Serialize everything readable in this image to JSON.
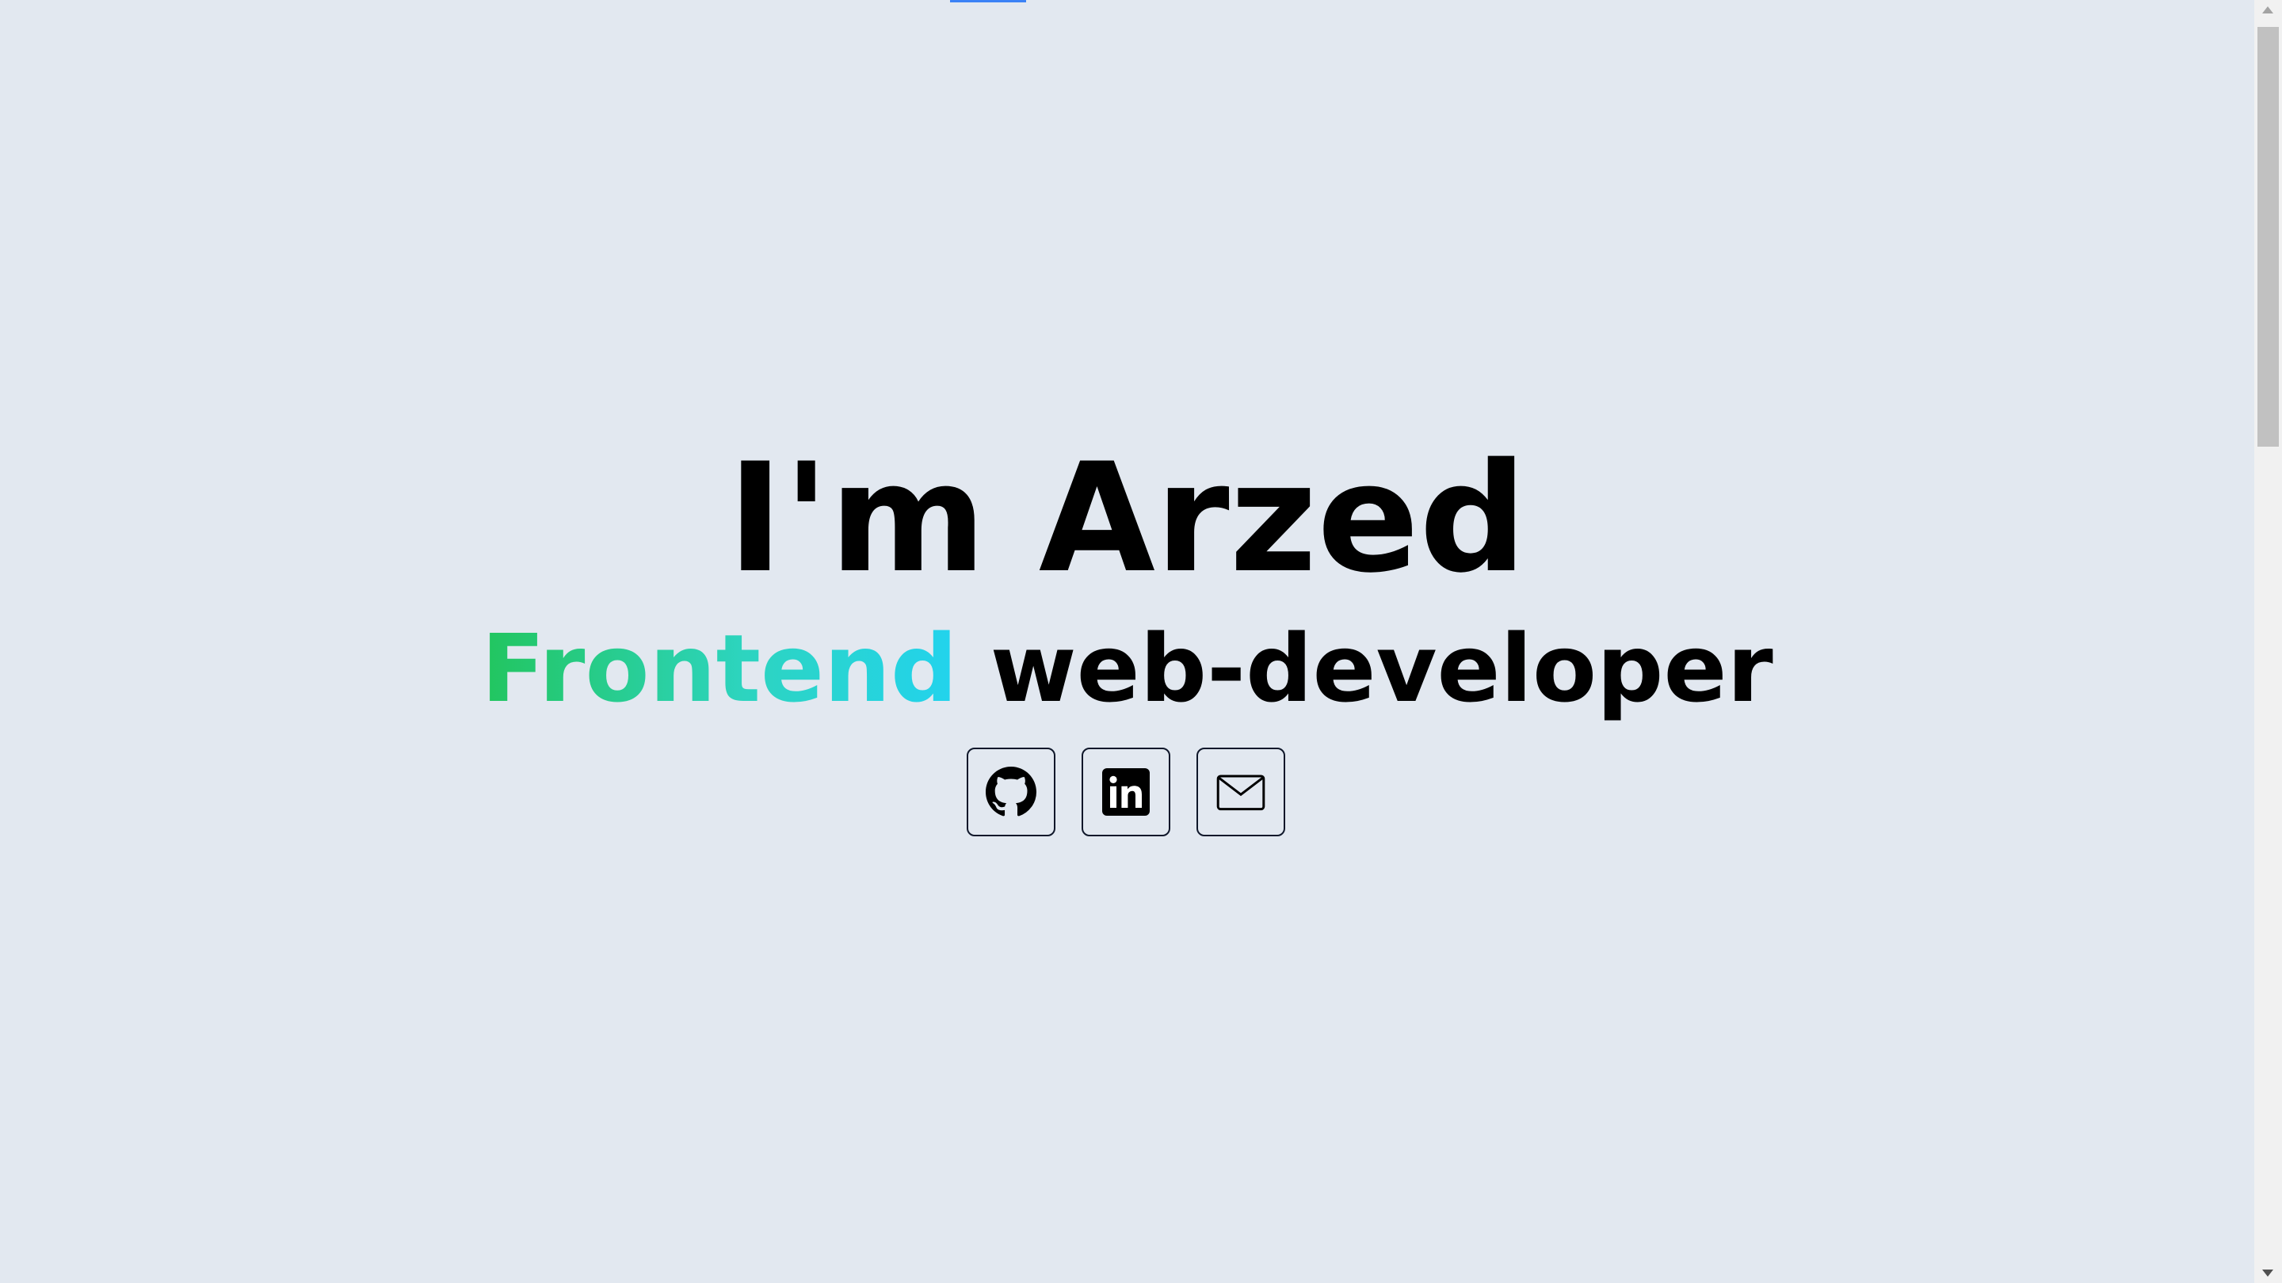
{
  "hero": {
    "title": "I'm Arzed",
    "subtitle_highlight": "Frontend",
    "subtitle_rest": "web-developer"
  },
  "socials": [
    {
      "icon": "github-icon"
    },
    {
      "icon": "linkedin-icon"
    },
    {
      "icon": "mail-icon"
    }
  ],
  "colors": {
    "background": "#e2e8f0",
    "gradient_start": "#22c55e",
    "gradient_end": "#22d3ee",
    "text": "#000000"
  }
}
